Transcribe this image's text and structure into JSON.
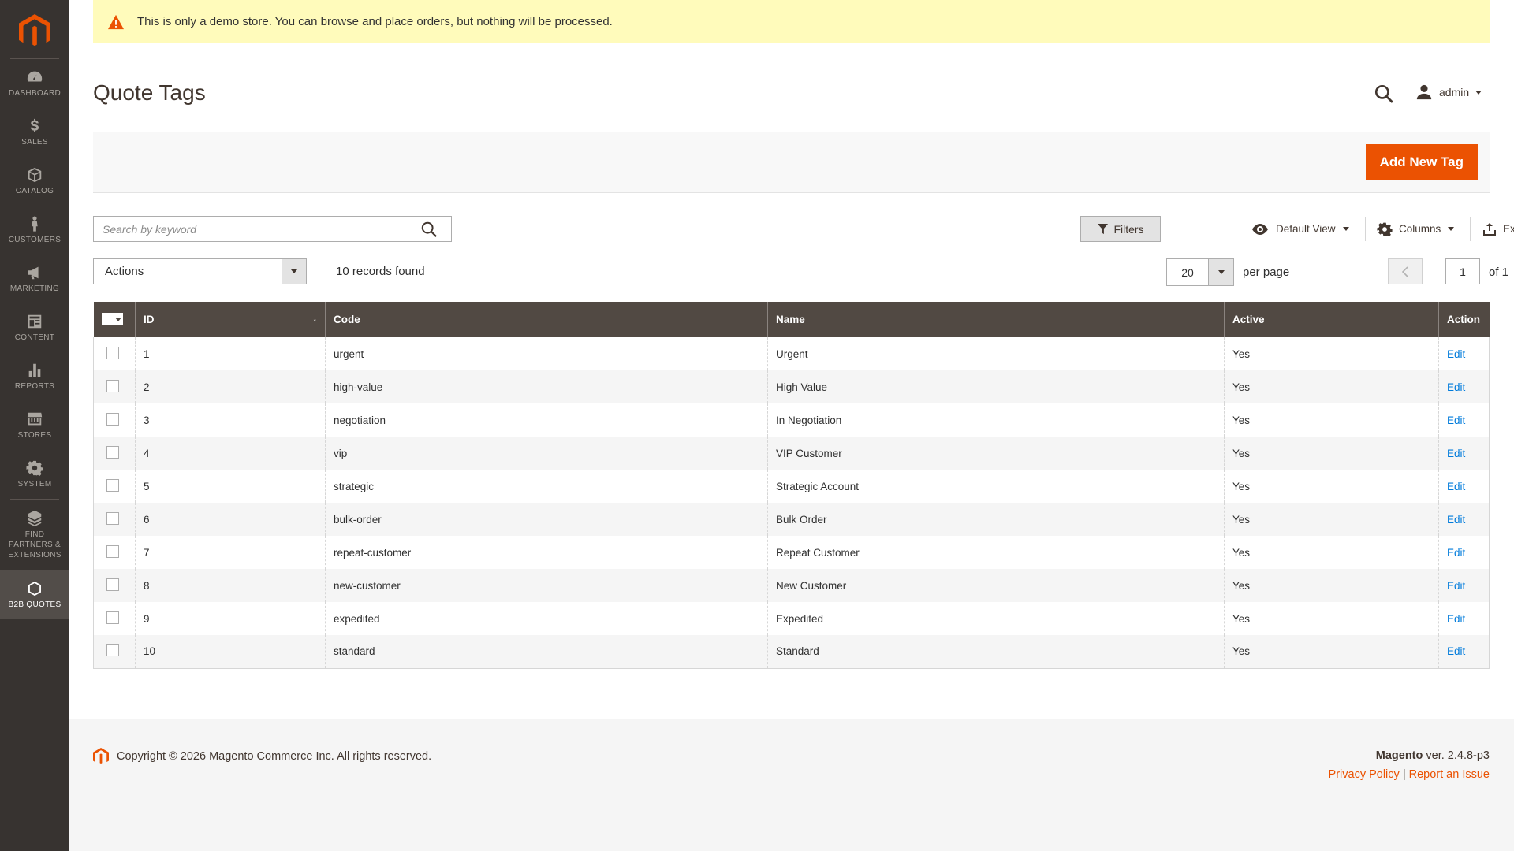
{
  "colors": {
    "accent": "#eb5202",
    "sidebar": "#373330",
    "header": "#514943",
    "link": "#007bdb",
    "notice": "#fffbbb"
  },
  "sidebar": {
    "items": [
      {
        "label": "Dashboard",
        "icon": "dashboard-icon"
      },
      {
        "label": "Sales",
        "icon": "dollar-icon"
      },
      {
        "label": "Catalog",
        "icon": "box-icon"
      },
      {
        "label": "Customers",
        "icon": "person-icon"
      },
      {
        "label": "Marketing",
        "icon": "megaphone-icon"
      },
      {
        "label": "Content",
        "icon": "layout-icon"
      },
      {
        "label": "Reports",
        "icon": "bar-chart-icon"
      },
      {
        "label": "Stores",
        "icon": "store-icon"
      },
      {
        "label": "System",
        "icon": "gear-icon"
      },
      {
        "label": "Find Partners & Extensions",
        "icon": "extensions-icon"
      },
      {
        "label": "B2B Quotes",
        "icon": "hexagon-icon"
      }
    ]
  },
  "notice": {
    "text": "This is only a demo store. You can browse and place orders, but nothing will be processed."
  },
  "header": {
    "title": "Quote Tags",
    "user": "admin"
  },
  "action_bar": {
    "add_button": "Add New Tag"
  },
  "toolbar": {
    "search_placeholder": "Search by keyword",
    "filters": "Filters",
    "default_view": "Default View",
    "columns": "Columns",
    "export": "Export",
    "actions": "Actions",
    "records": "10 records found",
    "per_page_value": "20",
    "per_page_label": "per page",
    "page": "1",
    "page_of": "of 1"
  },
  "grid": {
    "columns": [
      "ID",
      "Code",
      "Name",
      "Active",
      "Action"
    ],
    "rows": [
      {
        "id": "1",
        "code": "urgent",
        "name": "Urgent",
        "active": "Yes",
        "action": "Edit"
      },
      {
        "id": "2",
        "code": "high-value",
        "name": "High Value",
        "active": "Yes",
        "action": "Edit"
      },
      {
        "id": "3",
        "code": "negotiation",
        "name": "In Negotiation",
        "active": "Yes",
        "action": "Edit"
      },
      {
        "id": "4",
        "code": "vip",
        "name": "VIP Customer",
        "active": "Yes",
        "action": "Edit"
      },
      {
        "id": "5",
        "code": "strategic",
        "name": "Strategic Account",
        "active": "Yes",
        "action": "Edit"
      },
      {
        "id": "6",
        "code": "bulk-order",
        "name": "Bulk Order",
        "active": "Yes",
        "action": "Edit"
      },
      {
        "id": "7",
        "code": "repeat-customer",
        "name": "Repeat Customer",
        "active": "Yes",
        "action": "Edit"
      },
      {
        "id": "8",
        "code": "new-customer",
        "name": "New Customer",
        "active": "Yes",
        "action": "Edit"
      },
      {
        "id": "9",
        "code": "expedited",
        "name": "Expedited",
        "active": "Yes",
        "action": "Edit"
      },
      {
        "id": "10",
        "code": "standard",
        "name": "Standard",
        "active": "Yes",
        "action": "Edit"
      }
    ]
  },
  "footer": {
    "copyright": "Copyright © 2026 Magento Commerce Inc. All rights reserved.",
    "brand": "Magento",
    "version": "ver. 2.4.8-p3",
    "privacy": "Privacy Policy",
    "separator": "|",
    "report": "Report an Issue"
  }
}
